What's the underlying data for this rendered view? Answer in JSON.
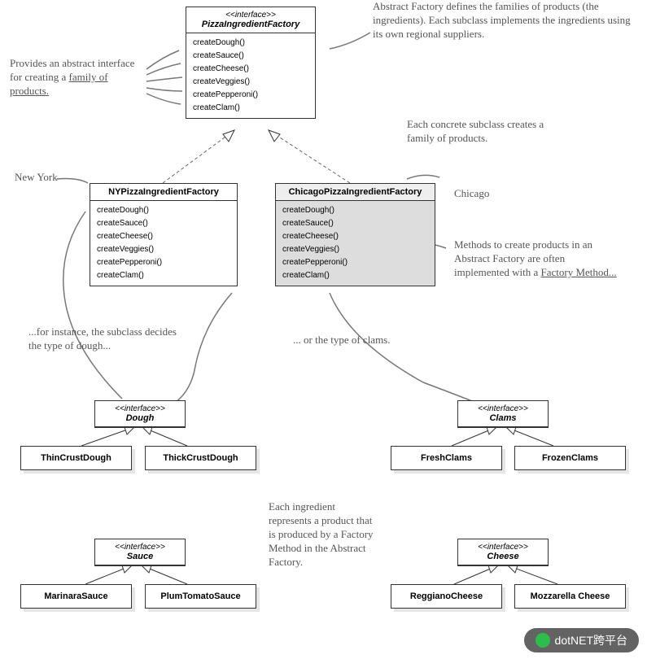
{
  "factory": {
    "stereo": "<<interface>>",
    "name": "PizzaIngredientFactory",
    "methods": [
      "createDough()",
      "createSauce()",
      "createCheese()",
      "createVeggies()",
      "createPepperoni()",
      "createClam()"
    ]
  },
  "ny": {
    "name": "NYPizzaIngredientFactory",
    "methods": [
      "createDough()",
      "createSauce()",
      "createCheese()",
      "createVeggies()",
      "createPepperoni()",
      "createClam()"
    ]
  },
  "chicago": {
    "name": "ChicagoPizzaIngredientFactory",
    "methods": [
      "createDough()",
      "createSauce()",
      "createCheese()",
      "createVeggies()",
      "createPepperoni()",
      "createClam()"
    ]
  },
  "dough": {
    "stereo": "<<interface>>",
    "name": "Dough",
    "impl": [
      "ThinCrustDough",
      "ThickCrustDough"
    ]
  },
  "clams": {
    "stereo": "<<interface>>",
    "name": "Clams",
    "impl": [
      "FreshClams",
      "FrozenClams"
    ]
  },
  "sauce": {
    "stereo": "<<interface>>",
    "name": "Sauce",
    "impl": [
      "MarinaraSauce",
      "PlumTomatoSauce"
    ]
  },
  "cheese": {
    "stereo": "<<interface>>",
    "name": "Cheese",
    "impl": [
      "ReggianoCheese",
      "Mozzarella Cheese"
    ]
  },
  "notes": {
    "top": "Abstract Factory defines the families of products (the ingredients). Each subclass implements the ingredients using its own regional suppliers.",
    "left": "Provides an abstract interface for creating a",
    "leftU": "family of products.",
    "ny": "New York",
    "chicago": "Chicago",
    "subclass": "Each concrete subclass creates a family of products.",
    "methods1": "Methods to create products in an Abstract Factory are often implemented with a",
    "methodsU": "Factory Method...",
    "instance": "...for instance, the subclass decides the type of dough...",
    "or": "... or the type of clams.",
    "ingredient": "Each ingredient represents a product that is produced by a Factory Method in the Abstract Factory."
  },
  "watermark": "dotNET跨平台"
}
